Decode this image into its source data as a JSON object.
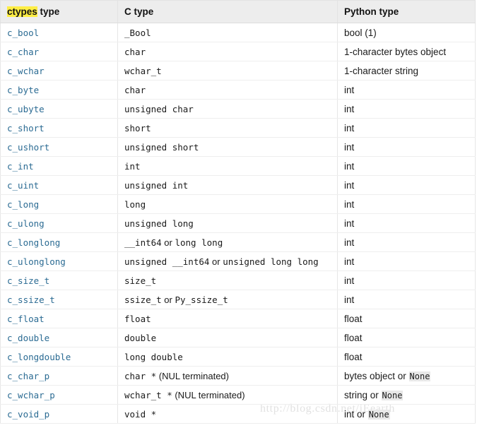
{
  "page": {
    "title": "ctypes fundamental data types table",
    "watermark": "http://blog.csdn.net/iEearth",
    "accent_link_color": "#2b6b93",
    "header_bg_color": "#ededed",
    "highlight_color": "#ffee44",
    "border_color": "#e6e6e6",
    "code_bg_color": "#e8e8e8"
  },
  "table": {
    "headers": {
      "col1_highlight": "ctypes",
      "col1_rest": " type",
      "col2": "C type",
      "col3": "Python type"
    },
    "rows": [
      {
        "ctypes": "c_bool",
        "c_parts": [
          {
            "text": "_Bool",
            "style": "lit"
          }
        ],
        "py_parts": [
          {
            "text": "bool (1)",
            "style": "text"
          }
        ]
      },
      {
        "ctypes": "c_char",
        "c_parts": [
          {
            "text": "char",
            "style": "lit"
          }
        ],
        "py_parts": [
          {
            "text": "1-character bytes object",
            "style": "text"
          }
        ]
      },
      {
        "ctypes": "c_wchar",
        "c_parts": [
          {
            "text": "wchar_t",
            "style": "lit"
          }
        ],
        "py_parts": [
          {
            "text": "1-character string",
            "style": "text"
          }
        ]
      },
      {
        "ctypes": "c_byte",
        "c_parts": [
          {
            "text": "char",
            "style": "lit"
          }
        ],
        "py_parts": [
          {
            "text": "int",
            "style": "text"
          }
        ]
      },
      {
        "ctypes": "c_ubyte",
        "c_parts": [
          {
            "text": "unsigned char",
            "style": "lit"
          }
        ],
        "py_parts": [
          {
            "text": "int",
            "style": "text"
          }
        ]
      },
      {
        "ctypes": "c_short",
        "c_parts": [
          {
            "text": "short",
            "style": "lit"
          }
        ],
        "py_parts": [
          {
            "text": "int",
            "style": "text"
          }
        ]
      },
      {
        "ctypes": "c_ushort",
        "c_parts": [
          {
            "text": "unsigned short",
            "style": "lit"
          }
        ],
        "py_parts": [
          {
            "text": "int",
            "style": "text"
          }
        ]
      },
      {
        "ctypes": "c_int",
        "c_parts": [
          {
            "text": "int",
            "style": "lit"
          }
        ],
        "py_parts": [
          {
            "text": "int",
            "style": "text"
          }
        ]
      },
      {
        "ctypes": "c_uint",
        "c_parts": [
          {
            "text": "unsigned int",
            "style": "lit"
          }
        ],
        "py_parts": [
          {
            "text": "int",
            "style": "text"
          }
        ]
      },
      {
        "ctypes": "c_long",
        "c_parts": [
          {
            "text": "long",
            "style": "lit"
          }
        ],
        "py_parts": [
          {
            "text": "int",
            "style": "text"
          }
        ]
      },
      {
        "ctypes": "c_ulong",
        "c_parts": [
          {
            "text": "unsigned long",
            "style": "lit"
          }
        ],
        "py_parts": [
          {
            "text": "int",
            "style": "text"
          }
        ]
      },
      {
        "ctypes": "c_longlong",
        "c_parts": [
          {
            "text": "__int64",
            "style": "lit"
          },
          {
            "text": " or ",
            "style": "prose"
          },
          {
            "text": "long long",
            "style": "lit"
          }
        ],
        "py_parts": [
          {
            "text": "int",
            "style": "text"
          }
        ]
      },
      {
        "ctypes": "c_ulonglong",
        "c_parts": [
          {
            "text": "unsigned __int64",
            "style": "lit"
          },
          {
            "text": " or ",
            "style": "prose"
          },
          {
            "text": "unsigned long long",
            "style": "lit"
          }
        ],
        "py_parts": [
          {
            "text": "int",
            "style": "text"
          }
        ]
      },
      {
        "ctypes": "c_size_t",
        "c_parts": [
          {
            "text": "size_t",
            "style": "lit"
          }
        ],
        "py_parts": [
          {
            "text": "int",
            "style": "text"
          }
        ]
      },
      {
        "ctypes": "c_ssize_t",
        "c_parts": [
          {
            "text": "ssize_t",
            "style": "lit"
          },
          {
            "text": " or ",
            "style": "prose"
          },
          {
            "text": "Py_ssize_t",
            "style": "lit"
          }
        ],
        "py_parts": [
          {
            "text": "int",
            "style": "text"
          }
        ]
      },
      {
        "ctypes": "c_float",
        "c_parts": [
          {
            "text": "float",
            "style": "lit"
          }
        ],
        "py_parts": [
          {
            "text": "float",
            "style": "text"
          }
        ]
      },
      {
        "ctypes": "c_double",
        "c_parts": [
          {
            "text": "double",
            "style": "lit"
          }
        ],
        "py_parts": [
          {
            "text": "float",
            "style": "text"
          }
        ]
      },
      {
        "ctypes": "c_longdouble",
        "c_parts": [
          {
            "text": "long double",
            "style": "lit"
          }
        ],
        "py_parts": [
          {
            "text": "float",
            "style": "text"
          }
        ]
      },
      {
        "ctypes": "c_char_p",
        "c_parts": [
          {
            "text": "char *",
            "style": "lit"
          },
          {
            "text": " (NUL terminated)",
            "style": "prose"
          }
        ],
        "py_parts": [
          {
            "text": "bytes object or ",
            "style": "text"
          },
          {
            "text": "None",
            "style": "pylit"
          }
        ]
      },
      {
        "ctypes": "c_wchar_p",
        "c_parts": [
          {
            "text": "wchar_t *",
            "style": "lit"
          },
          {
            "text": " (NUL terminated)",
            "style": "prose"
          }
        ],
        "py_parts": [
          {
            "text": "string or ",
            "style": "text"
          },
          {
            "text": "None",
            "style": "pylit"
          }
        ]
      },
      {
        "ctypes": "c_void_p",
        "c_parts": [
          {
            "text": "void *",
            "style": "lit"
          }
        ],
        "py_parts": [
          {
            "text": "int or ",
            "style": "text"
          },
          {
            "text": "None",
            "style": "pylit"
          }
        ]
      }
    ]
  }
}
